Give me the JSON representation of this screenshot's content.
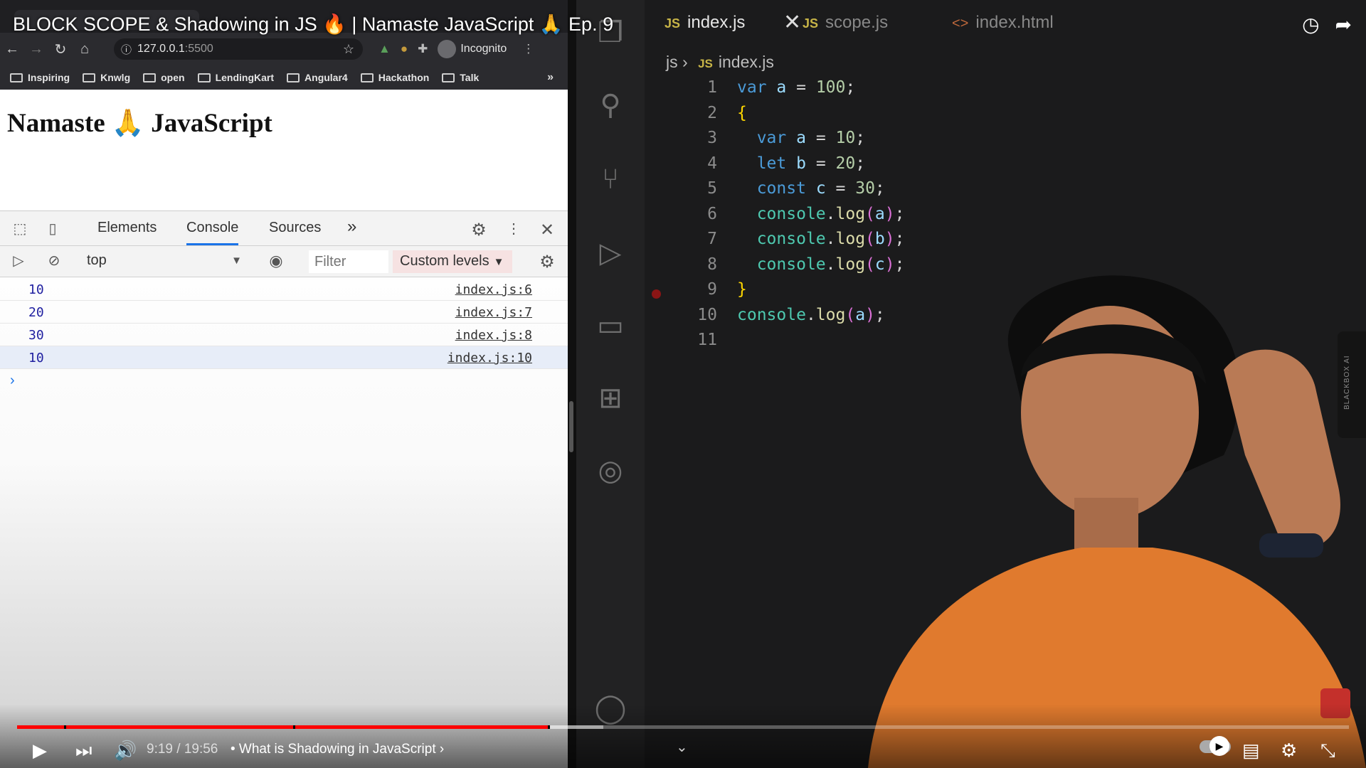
{
  "video": {
    "title": "BLOCK SCOPE & Shadowing in JS 🔥 | Namaste JavaScript 🙏 Ep. 9",
    "time": "9:19 / 19:56",
    "chapter": "• What is Shadowing in JavaScript ›",
    "progress_played_fraction": 0.4,
    "progress_loaded_fraction": 0.44
  },
  "browser": {
    "url_host": "127.0.0.1",
    "url_port": ":5500",
    "incognito_label": "Incognito",
    "bookmarks": [
      "Inspiring",
      "Knwlg",
      "open",
      "LendingKart",
      "Angular4",
      "Hackathon",
      "Talk"
    ],
    "bookmarks_more": "»",
    "page_heading": "Namaste 🙏 JavaScript"
  },
  "devtools": {
    "tabs": [
      "Elements",
      "Console",
      "Sources"
    ],
    "more_tabs": "»",
    "context": "top",
    "filter_placeholder": "Filter",
    "levels": "Custom levels",
    "logs": [
      {
        "value": "10",
        "source": "index.js:6"
      },
      {
        "value": "20",
        "source": "index.js:7"
      },
      {
        "value": "30",
        "source": "index.js:8"
      },
      {
        "value": "10",
        "source": "index.js:10"
      }
    ],
    "prompt": "›"
  },
  "editor": {
    "tabs": [
      {
        "label": "index.js",
        "type": "JS"
      },
      {
        "label": "scope.js",
        "type": "JS"
      },
      {
        "label": "index.html",
        "type": "<>"
      }
    ],
    "breadcrumb_folder": "js",
    "breadcrumb_sep": "›",
    "breadcrumb_file": "index.js",
    "line_numbers": [
      "1",
      "2",
      "3",
      "4",
      "5",
      "6",
      "7",
      "8",
      "9",
      "10",
      "11"
    ],
    "sidebar_label": "BLACKBOX AI"
  },
  "colors": {
    "progress": "#ff0000",
    "accent": "#1a73e8"
  }
}
